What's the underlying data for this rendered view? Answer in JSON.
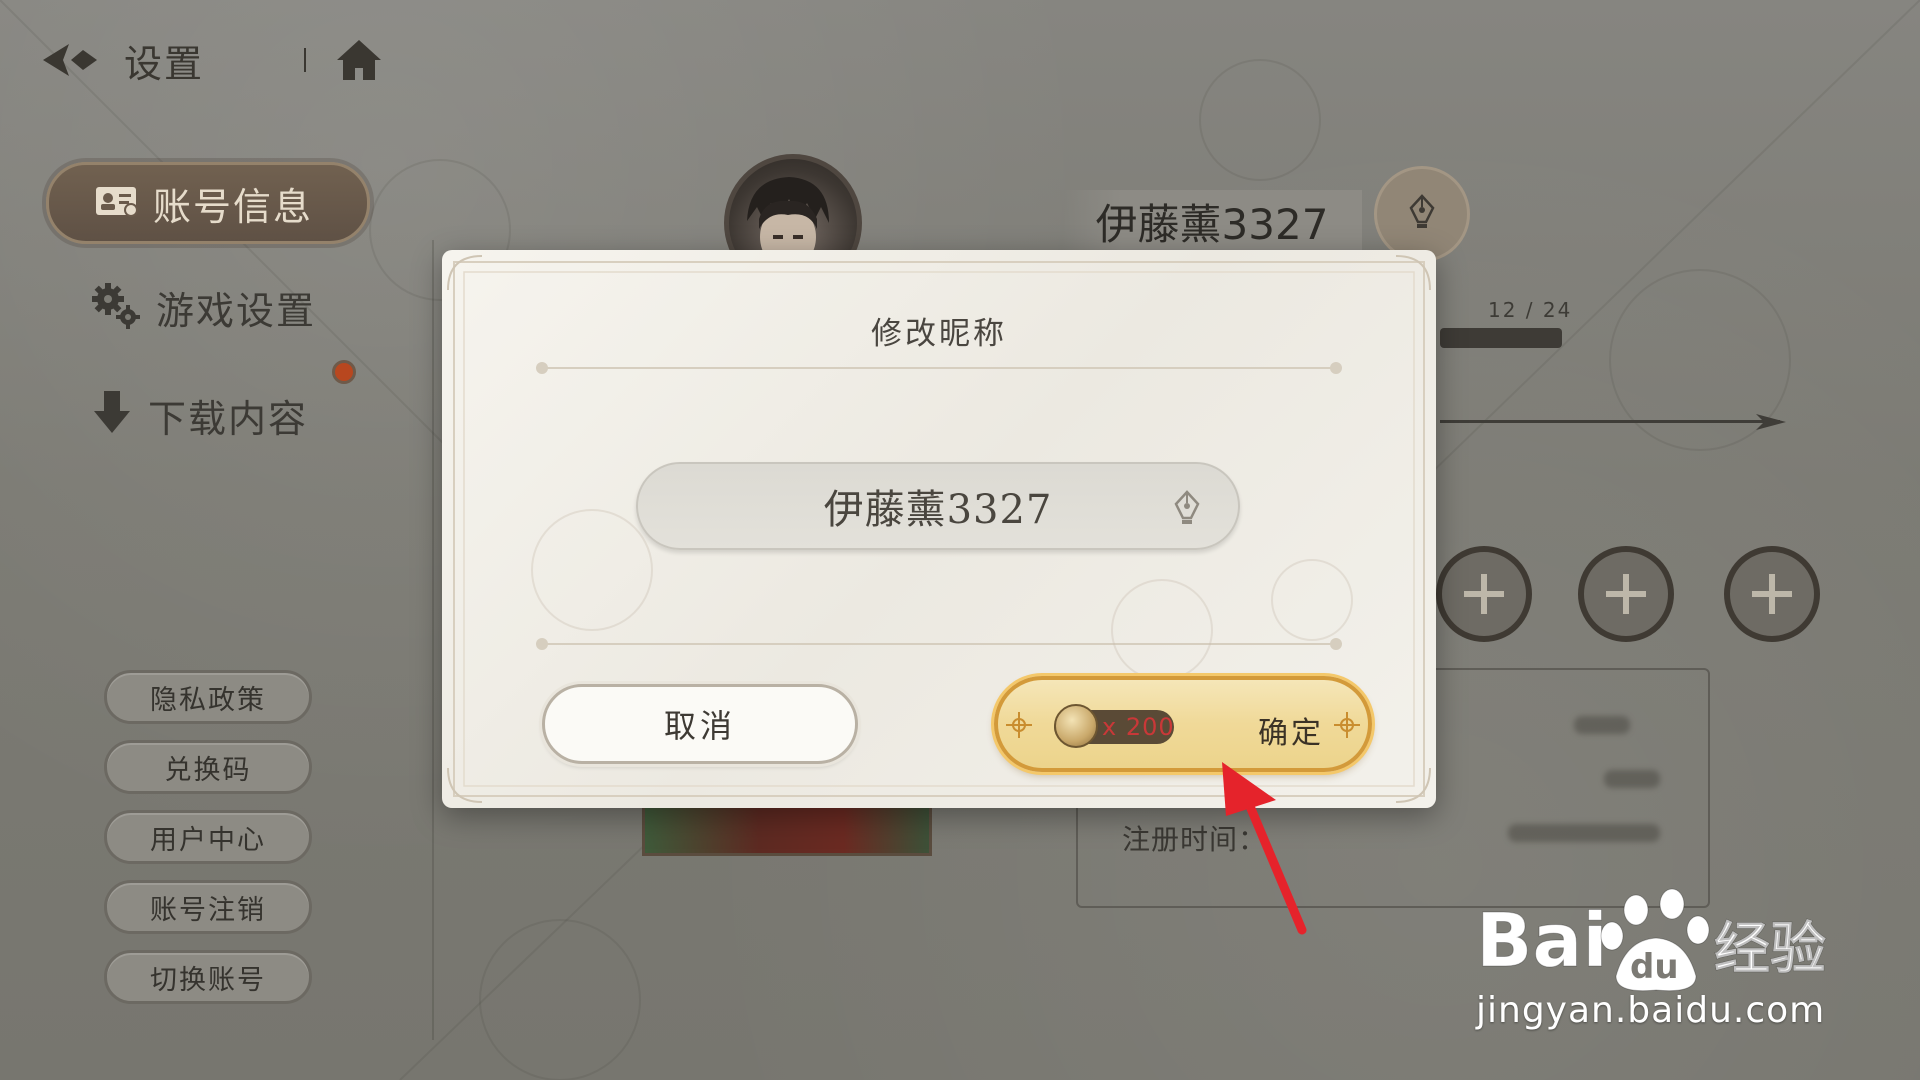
{
  "topbar": {
    "title": "设置"
  },
  "nav": {
    "items": [
      {
        "label": "账号信息",
        "active": true
      },
      {
        "label": "游戏设置"
      },
      {
        "label": "下载内容"
      }
    ]
  },
  "side_buttons": [
    "隐私政策",
    "兑换码",
    "用户中心",
    "账号注销",
    "切换账号"
  ],
  "profile": {
    "nickname": "伊藤薰3327",
    "progress": "12 / 24",
    "registration_label": "注册时间："
  },
  "dialog": {
    "title": "修改昵称",
    "input_value": "伊藤薰3327",
    "cancel_label": "取消",
    "confirm_label": "确定",
    "cost": "x 200"
  },
  "watermark": {
    "logo_text": "Baidu经验",
    "url": "jingyan.baidu.com"
  },
  "colors": {
    "accent_gold": "#d39a3a",
    "cost_red": "#c93838",
    "annotation_red": "#e5232b"
  }
}
